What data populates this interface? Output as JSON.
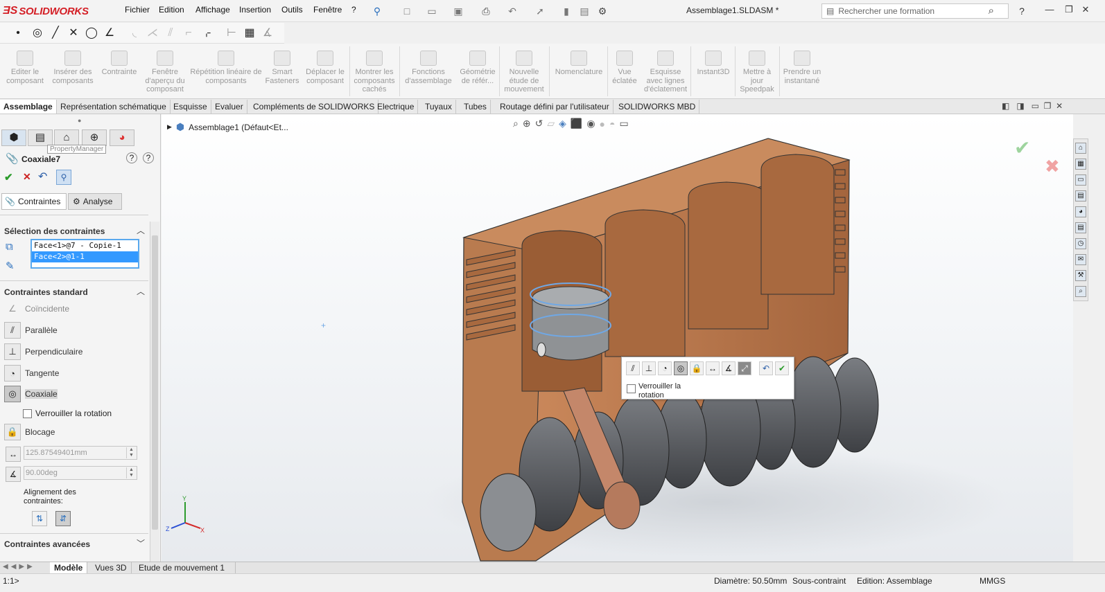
{
  "app": {
    "logo": "SOLIDWORKS",
    "menus": [
      "Fichier",
      "Edition",
      "Affichage",
      "Insertion",
      "Outils",
      "Fenêtre",
      "?"
    ],
    "document_title": "Assemblage1.SLDASM *",
    "search_placeholder": "Rechercher une formation"
  },
  "commands": [
    "Editer le composant",
    "Insérer des composants",
    "Contrainte",
    "Fenêtre d'aperçu du composant",
    "Répétition linéaire de composants",
    "Smart Fasteners",
    "Déplacer le composant",
    "Montrer les composants cachés",
    "Fonctions d'assemblage",
    "Géométrie de référ...",
    "Nouvelle étude de mouvement",
    "Nomenclature",
    "Vue éclatée",
    "Esquisse avec lignes d'éclatement",
    "Instant3D",
    "Mettre à jour Speedpak",
    "Prendre un instantané"
  ],
  "tabs": [
    "Assemblage",
    "Représentation schématique",
    "Esquisse",
    "Evaluer",
    "Compléments de SOLIDWORKS",
    "Electrique",
    "Tuyaux",
    "Tubes",
    "Routage défini par l'utilisateur",
    "SOLIDWORKS MBD"
  ],
  "panel": {
    "tooltip": "PropertyManager",
    "title": "Coaxiale7",
    "subtabs": [
      "Contraintes",
      "Analyse"
    ],
    "selection_header": "Sélection des contraintes",
    "selections": [
      "Face<1>@7 - Copie-1",
      "Face<2>@1-1"
    ],
    "standard_header": "Contraintes standard",
    "mates": [
      "Coïncidente",
      "Parallèle",
      "Perpendiculaire",
      "Tangente",
      "Coaxiale",
      "Blocage"
    ],
    "lock_rotation": "Verrouiller la rotation",
    "distance": "125.87549401mm",
    "angle": "90.00deg",
    "alignment": "Alignement des contraintes:",
    "advanced_header": "Contraintes avancées"
  },
  "tree": {
    "root": "Assemblage1  (Défaut<Et..."
  },
  "context": {
    "lock_rotation": "Verrouiller la rotation"
  },
  "triad": {
    "x": "X",
    "y": "Y",
    "z": "Z"
  },
  "bottom_tabs": [
    "Modèle",
    "Vues 3D",
    "Etude de mouvement 1"
  ],
  "status": {
    "left": "1:1>",
    "diameter": "Diamètre: 50.50mm",
    "state": "Sous-contraint",
    "mode": "Edition: Assemblage",
    "units": "MMGS"
  },
  "colors": {
    "accent": "#d41f26",
    "selection": "#3399ff",
    "block": "#b5764e",
    "crank": "#5c5f63"
  }
}
